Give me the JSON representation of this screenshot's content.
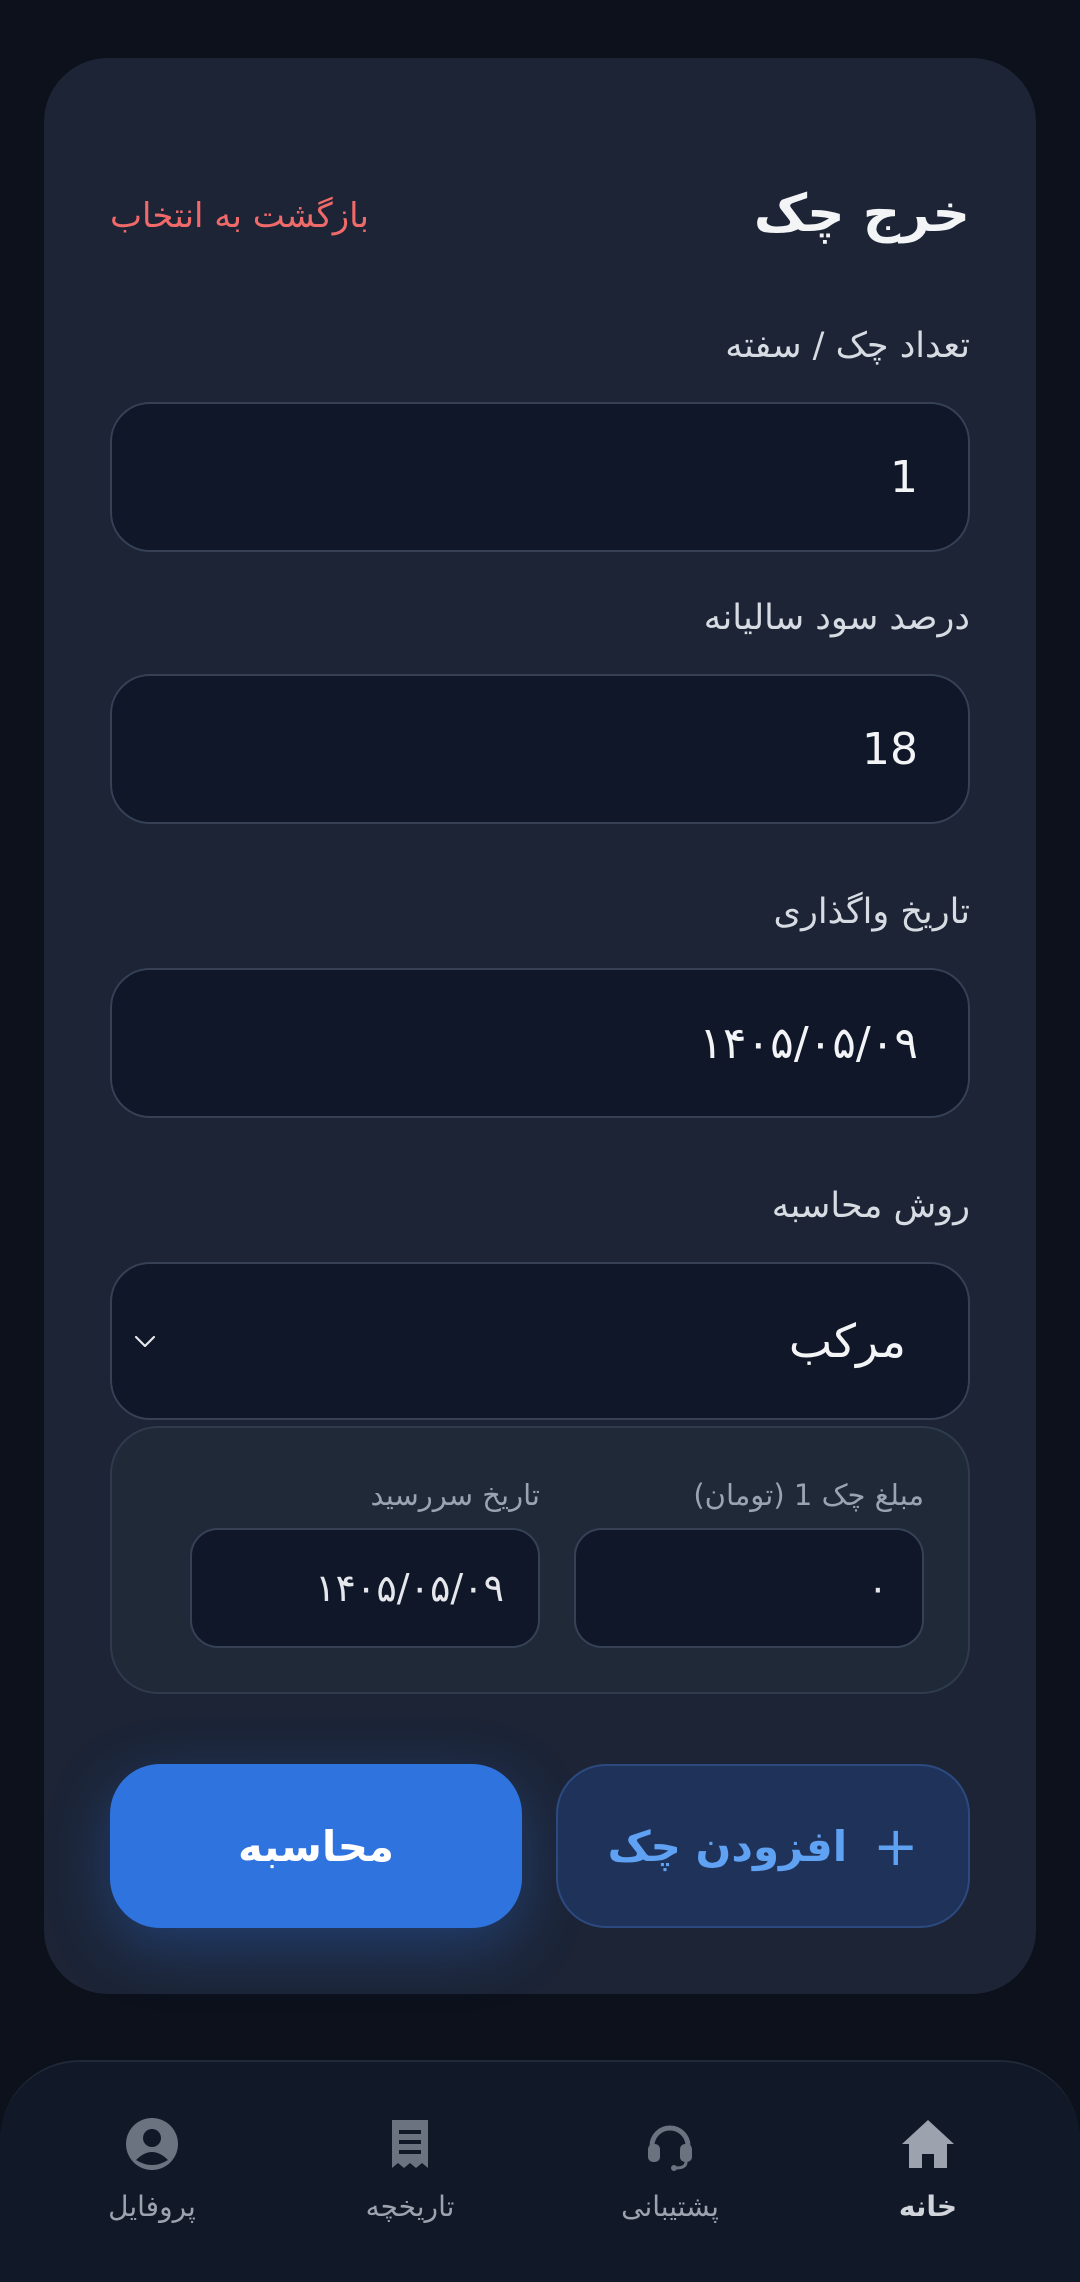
{
  "form": {
    "title": "خرج چک",
    "back_link": "بازگشت به انتخاب",
    "cheque_count_label": "تعداد چک / سفته",
    "cheque_count_value": "1",
    "annual_rate_label": "درصد سود سالیانه",
    "annual_rate_value": "18",
    "assign_date_label": "تاریخ واگذاری",
    "assign_date_value": "۱۴۰۵/۰۵/۰۹",
    "method_label": "روش محاسبه",
    "method_value": "مرکب"
  },
  "cheque": {
    "amount_label": "مبلغ چک 1 (تومان)",
    "amount_value": "۰",
    "due_date_label": "تاریخ سررسید",
    "due_date_value": "۱۴۰۵/۰۵/۰۹"
  },
  "actions": {
    "add_cheque": "افزودن چک",
    "calculate": "محاسبه"
  },
  "nav": {
    "home": "خانه",
    "support": "پشتیبانی",
    "history": "تاریخچه",
    "profile": "پروفایل"
  },
  "colors": {
    "accent": "#2f73de",
    "danger_link": "#f16a6a",
    "background": "#0c111b",
    "card": "#1c2436"
  }
}
